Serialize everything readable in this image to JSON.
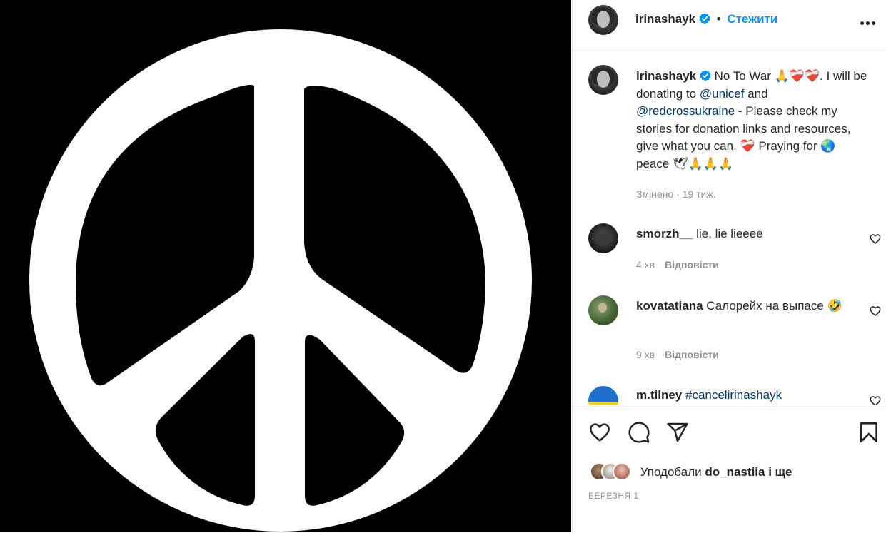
{
  "post": {
    "username": "irinashayk",
    "follow_label": "Стежити",
    "caption_start": "No To War 🙏❤️‍🩹❤️‍🩹. I will be donating to ",
    "mention_1": "@unicef",
    "caption_and": " and ",
    "mention_2": "@redcrossukraine",
    "caption_end": " - Please check my stories for donation links and resources, give what you can. ❤️‍🩹 Praying for 🌏peace 🕊🙏🙏🙏",
    "edited_label": "Змінено",
    "time": "19 тиж.",
    "edited_time": "Змінено · 19 тиж."
  },
  "comments": [
    {
      "username": "smorzh__",
      "text": "lie, lie lieeee",
      "time": "4 хв",
      "reply_label": "Відповісти"
    },
    {
      "username": "kovatatiana",
      "text": "Салорейх на выпасе 🤣",
      "time": "9 хв",
      "reply_label": "Відповісти"
    },
    {
      "username": "m.tilney",
      "text": "#cancelirinashayk"
    }
  ],
  "likes": {
    "prefix": "Уподобали",
    "user": "do_nastiia",
    "suffix": "і ще"
  },
  "date": "БЕРЕЗНЯ 1",
  "icons": {
    "verified": "verified-badge-icon",
    "more": "more-options-icon",
    "like": "heart-icon",
    "comment": "comment-icon",
    "share": "share-icon",
    "save": "bookmark-icon"
  },
  "colors": {
    "accent": "#0095f6",
    "mention": "#00376b",
    "muted": "#8e8e8e"
  }
}
